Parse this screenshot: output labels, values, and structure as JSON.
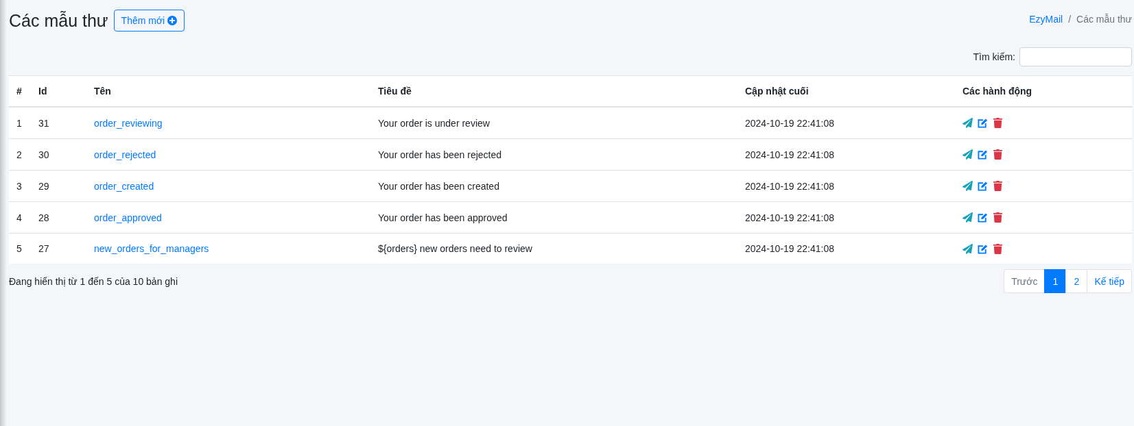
{
  "page": {
    "title": "Các mẫu thư",
    "add_button": "Thêm mới"
  },
  "breadcrumb": {
    "separator": "/",
    "items": [
      {
        "label": "EzyMail",
        "kind": "link"
      },
      {
        "label": "Các mẫu thư",
        "kind": "current"
      }
    ]
  },
  "search": {
    "label": "Tìm kiếm:"
  },
  "table": {
    "columns": [
      "#",
      "Id",
      "Tên",
      "Tiêu đề",
      "Cập nhật cuối",
      "Các hành động"
    ],
    "rows": [
      {
        "index": "1",
        "id": "31",
        "name": "order_reviewing",
        "subject": "Your order is under review",
        "updated": "2024-10-19 22:41:08"
      },
      {
        "index": "2",
        "id": "30",
        "name": "order_rejected",
        "subject": "Your order has been rejected",
        "updated": "2024-10-19 22:41:08"
      },
      {
        "index": "3",
        "id": "29",
        "name": "order_created",
        "subject": "Your order has been created",
        "updated": "2024-10-19 22:41:08"
      },
      {
        "index": "4",
        "id": "28",
        "name": "order_approved",
        "subject": "Your order has been approved",
        "updated": "2024-10-19 22:41:08"
      },
      {
        "index": "5",
        "id": "27",
        "name": "new_orders_for_managers",
        "subject": "${orders} new orders need to review",
        "updated": "2024-10-19 22:41:08"
      }
    ]
  },
  "footer": {
    "info": "Đang hiển thị từ 1 đến 5 của 10 bản ghi"
  },
  "pagination": [
    {
      "label": "Trước",
      "kind": "prev",
      "selected": false,
      "disabled": true
    },
    {
      "label": "1",
      "kind": "page",
      "selected": true,
      "disabled": false
    },
    {
      "label": "2",
      "kind": "page",
      "selected": false,
      "disabled": false
    },
    {
      "label": "Kế tiếp",
      "kind": "next",
      "selected": false,
      "disabled": false
    }
  ]
}
